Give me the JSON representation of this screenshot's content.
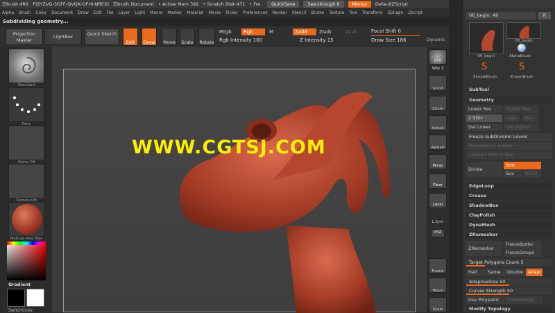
{
  "titlebar": {
    "app": "ZBrush 4R6",
    "license": "P2[YZVG-3GFF-QVQX-OFHI-NREX]",
    "document": "ZBrush Document",
    "active_mem": "• Active Mem 392",
    "scratch_disk": "• Scratch Disk 471",
    "free": "• Fre",
    "quicksave": "QuickSave",
    "see_through": "See-through  0",
    "menus": "Menus",
    "default_script": "DefaultZScript"
  },
  "menubar": [
    "Alpha",
    "Brush",
    "Color",
    "Document",
    "Draw",
    "Edit",
    "File",
    "Layer",
    "Light",
    "Macro",
    "Marker",
    "Material",
    "Movie",
    "Picker",
    "Preferences",
    "Render",
    "Stencil",
    "Stroke",
    "Texture",
    "Tool",
    "Transform",
    "Zplugin",
    "Zscript"
  ],
  "status": "Subdividing geometry...",
  "toolbar": {
    "projection_master": "Projection Master",
    "lightbox": "LightBox",
    "quick_sketch": "Quick Sketch",
    "edit": "Edit",
    "draw": "Draw",
    "move": "Move",
    "scale": "Scale",
    "rotate": "Rotate",
    "mrgb": "Mrgb",
    "rgb": "Rgb",
    "m": "M",
    "zadd": "Zadd",
    "zsub": "Zsub",
    "zcut": "Zcut",
    "rgb_intensity": "Rgb Intensity 100",
    "z_intensity": "Z Intensity 15",
    "focal_shift": "Focal Shift 0",
    "draw_size": "Draw Size 186",
    "dynamic": "Dynamic"
  },
  "left": {
    "standard": "Standard",
    "dots": "Dots",
    "alpha_off": "Alpha Off",
    "texture_off": "Texture Off",
    "material": "MatCap Red Wax",
    "gradient": "Gradient",
    "switch_color": "SwitchColor"
  },
  "watermark": "WWW.CGTSJ.COM",
  "shelf": [
    "BPR",
    "SPix 3",
    "Scroll",
    "Zoom",
    "Actual",
    "AAHalf",
    "Persp",
    "Floor",
    "Local",
    "L.Sym",
    "XYZ",
    "Frame",
    "Move",
    "Scale"
  ],
  "palette": {
    "tool_name": "06_begin. 49",
    "r": "R",
    "thumb1": "06_begin",
    "thumb2": "06_begin",
    "simplebrush": "SimpleBrush",
    "alphabrush": "AlphaBrush",
    "eraserbrush": "EraserBrush",
    "subtool": "SubTool",
    "geometry": "Geometry",
    "lower_res": "Lower Res",
    "higher_res": "Higher Res",
    "sdiv": "2 SDiv",
    "cage": "Cage",
    "rstr": "Rstr",
    "del_lower": "Del Lower",
    "del_higher": "Del Higher",
    "freeze_sub": "Freeze SubDivision Levels",
    "reconstruct": "Reconstruct Subdiv",
    "convert": "Convert BPR To Geo",
    "divide": "Divide",
    "smt": "Smt",
    "suv": "Suv",
    "reuv": "ReUV",
    "edgeloop": "EdgeLoop",
    "crease": "Crease",
    "shadowbox": "ShadowBox",
    "claypolish": "ClayPolish",
    "dynamesh": "DynaMesh",
    "zremesher_head": "ZRemesher",
    "zremesher": "ZRemesher",
    "freezeborder": "FreezeBorder",
    "freezegroups": "FreezeGroups",
    "target": "Target Polygons Count 5",
    "half": "Half",
    "same": "Same",
    "double": "Double",
    "adapt": "Adapt",
    "adaptivesize": "AdaptiveSize 50",
    "curves": "Curves Strength 50",
    "polypaint": "Use Polypaint",
    "colordensity": "ColorDensity",
    "modify": "Modify Topology"
  },
  "colors": {
    "accent": "#e86a1c",
    "model": "#b5472f",
    "watermark": "#ffee00"
  }
}
